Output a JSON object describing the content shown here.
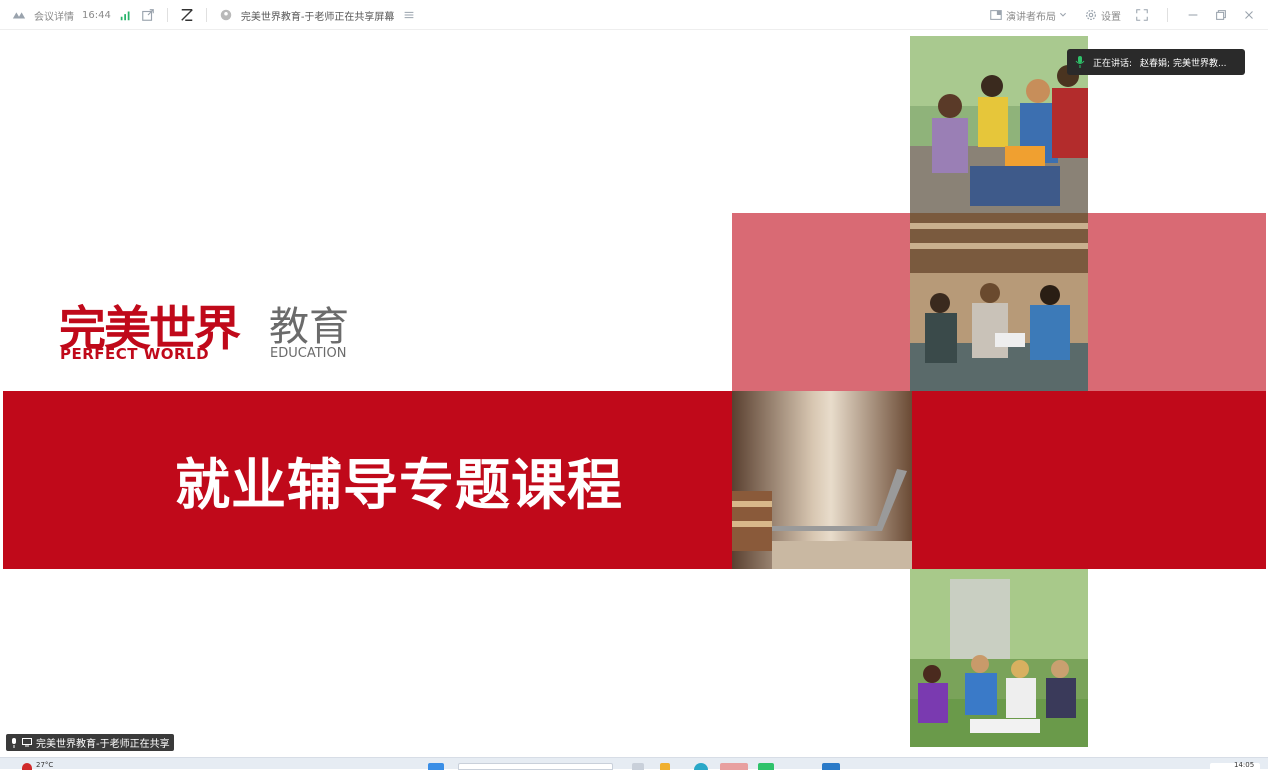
{
  "topbar": {
    "meeting_details": "会议详情",
    "time": "16:44",
    "share_title": "完美世界教育-于老师正在共享屏幕",
    "layout_label": "演讲者布局",
    "settings_label": "设置"
  },
  "slide": {
    "logo_cn": "完美世界",
    "logo_en": "PERFECT WORLD",
    "logo_cn2": "教育",
    "logo_en2": "EDUCATION",
    "title": "就业辅导专题课程"
  },
  "speaking": {
    "prefix": "正在讲话:",
    "names": "赵春娟; 完美世界教..."
  },
  "share_label": "完美世界教育-于老师正在共享",
  "taskbar": {
    "temperature": "27°C",
    "clock": "14:05"
  },
  "colors": {
    "brand_red": "#c0091a",
    "pink": "#d96a74",
    "logo_gray": "#6b6b6b"
  }
}
